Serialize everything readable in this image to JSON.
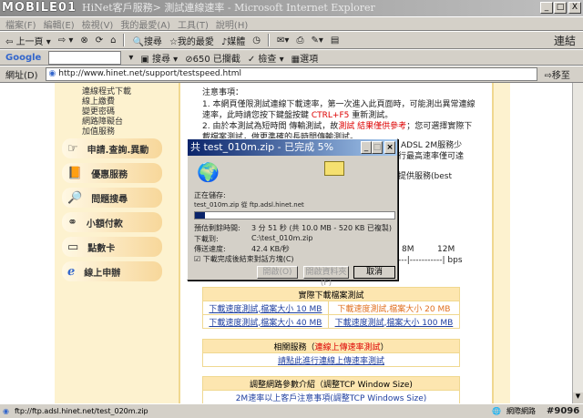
{
  "window": {
    "title": "HiNet客戶服務> 測試連線速率 - Microsoft Internet Explorer",
    "logo": "MOBILE01",
    "min": "_",
    "max": "□",
    "close": "X"
  },
  "menu": [
    "檔案(F)",
    "編輯(E)",
    "檢視(V)",
    "我的最愛(A)",
    "工具(T)",
    "說明(H)"
  ],
  "toolbar": {
    "back": "上一頁",
    "search": "搜尋",
    "favorites": "我的最愛",
    "media": "媒體",
    "links": "連結"
  },
  "google": {
    "logo": "Google",
    "search": "搜尋",
    "blocked": "650 已攔截",
    "check": "檢查",
    "options": "選項"
  },
  "address": {
    "label": "網址(D)",
    "url": "http://www.hinet.net/support/testspeed.html",
    "go": "移至"
  },
  "sidebar": {
    "sublinks": [
      "連線程式下載",
      "線上繳費",
      "變更密碼",
      "網路障礙台",
      "加值服務"
    ],
    "buttons": [
      "申請.查詢.異動",
      "優惠服務",
      "問題搜尋",
      "小額付款",
      "點數卡",
      "線上申辦"
    ]
  },
  "notes": {
    "heading": "注意事項：",
    "p1a": "1. 本網頁僅限測試連線下載速率，第一次進入此頁面時，可能測出異常連線速率，此時請您按下鍵盤按鍵 ",
    "p1key": "CTRL+F5",
    "p1b": " 重新測試。",
    "p2a": "2. 由於本測試為短時間 傳輸測試，故",
    "p2red": "測試 結果僅供參考",
    "p2b": "；您可選擇實際下載檔案測試，做更準確的長時間傳輸測試。",
    "side1": "ADSL 2M服務少",
    "side2": "行最高速率僅可達",
    "side3": "提供服務(best",
    "scale": [
      "8M",
      "12M"
    ],
    "bps": "| bps"
  },
  "dialog": {
    "title": "共 test_010m.zip - 已完成 5%",
    "saving": "正在儲存:",
    "from": "test_010m.zip 從 ftp.adsl.hinet.net",
    "progress": 5,
    "eta_label": "預估剩餘時間:",
    "eta": "3 分 51 秒 (共 10.0 MB - 520 KB 已複製)",
    "to_label": "下載到:",
    "to": "C:\\test_010m.zip",
    "rate_label": "傳送速度:",
    "rate": "42.4 KB/秒",
    "close_check": "下載完成後結束對話方塊(C)",
    "open": "開啟(O)",
    "open_folder": "開啟資料夾(F)",
    "cancel": "取消"
  },
  "tables": {
    "t1_header": "實際下載檔案測試",
    "t1": [
      "下載速度測試,檔案大小 10 MB",
      "下載速度測試,檔案大小 20 MB",
      "下載速度測試,檔案大小 40 MB",
      "下載速度測試,檔案大小 100 MB"
    ],
    "t2_header": "相關服務（",
    "t2_red": "連線上傳速率測試",
    "t2_close": "）",
    "t2_link": "請點此進行連線上傳速率測試",
    "t3_header": "調整網路參數介紹（調整TCP Window Size)",
    "t3_row": "2M速率以上客戶注意事項(調整TCP Windows Size)"
  },
  "status": {
    "url": "ftp://ftp.adsl.hinet.net/test_020m.zip",
    "zone": "網際網路",
    "watermark": "#9096"
  }
}
